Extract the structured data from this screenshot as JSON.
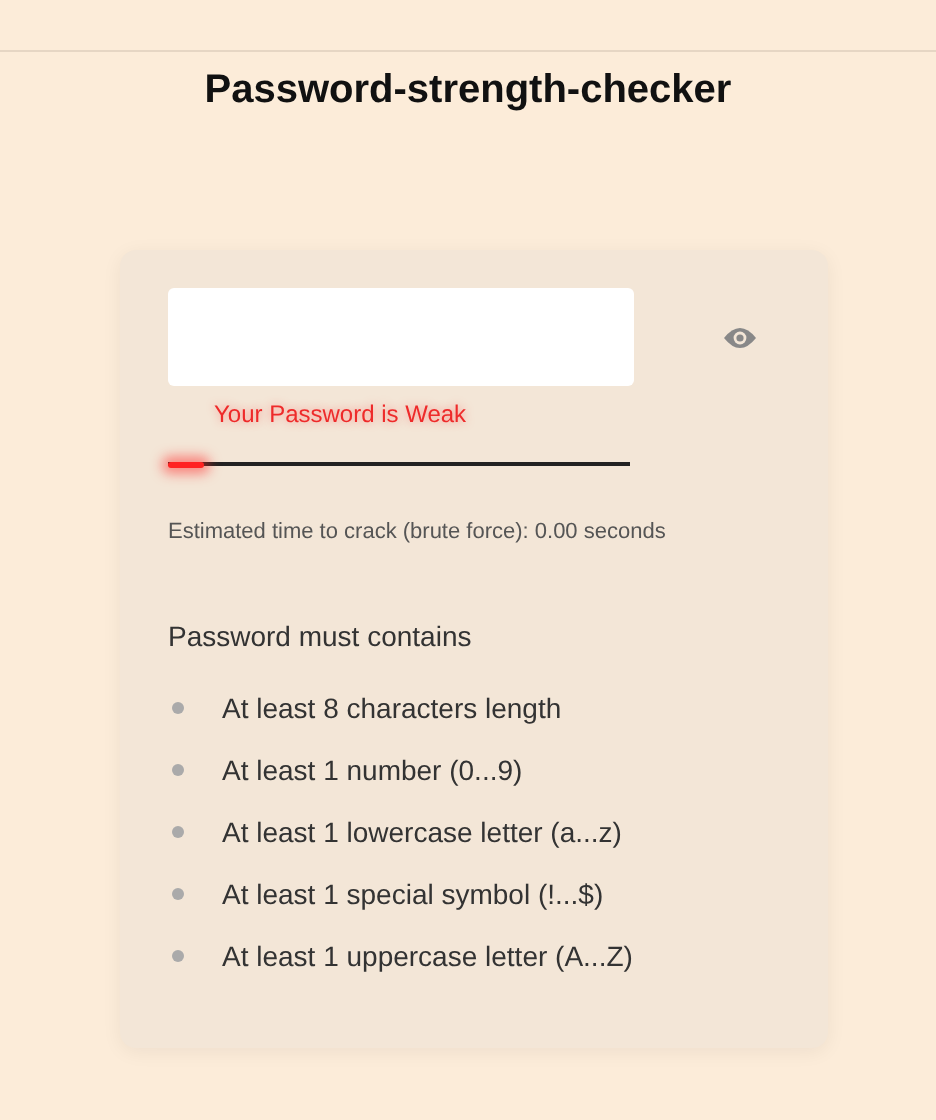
{
  "title": "Password-strength-checker",
  "strength": {
    "message": "Your Password is Weak",
    "level": 0.08
  },
  "crack_time": "Estimated time to crack (brute force): 0.00 seconds",
  "requirements_heading": "Password must contains",
  "requirements": [
    {
      "label": "At least 8 characters length",
      "met": false
    },
    {
      "label": "At least 1 number (0...9)",
      "met": false
    },
    {
      "label": "At least 1 lowercase letter (a...z)",
      "met": false
    },
    {
      "label": "At least 1 special symbol (!...$)",
      "met": false
    },
    {
      "label": "At least 1 uppercase letter (A...Z)",
      "met": false
    }
  ]
}
